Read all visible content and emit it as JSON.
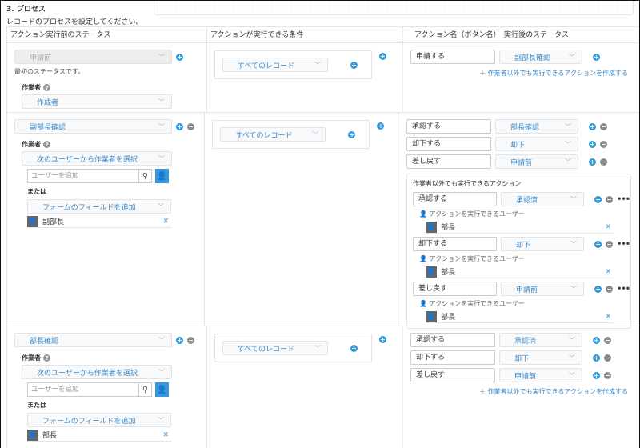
{
  "section_title": "3. プロセス",
  "subtitle": "レコードのプロセスを設定してください。",
  "headers": {
    "status_before": "アクション実行前のステータス",
    "condition": "アクションが実行できる条件",
    "action_name": "アクション名（ボタン名）",
    "status_after": "実行後のステータス"
  },
  "labels": {
    "assignee": "作業者",
    "or": "または",
    "user_search_placeholder": "ユーザーを追加",
    "first_status_note": "最初のステータスです。",
    "add_other_action": "＋ 作業者以外でも実行できるアクションを作成する",
    "other_actions_title": "作業者以外でも実行できるアクション",
    "action_users": "アクションを実行できるユーザー"
  },
  "rows": [
    {
      "status": "申請前",
      "assignee_mode": "作成者",
      "condition": "すべてのレコード",
      "actions": [
        {
          "name": "申請する",
          "next": "副部長確認"
        }
      ]
    },
    {
      "status": "副部長確認",
      "assignee_mode": "次のユーザーから作業者を選択",
      "field_select": "フォームのフィールドを追加",
      "assignee": "副部長",
      "condition": "すべてのレコード",
      "actions": [
        {
          "name": "承認する",
          "next": "部長確認"
        },
        {
          "name": "却下する",
          "next": "却下"
        },
        {
          "name": "差し戻す",
          "next": "申請前"
        }
      ],
      "other_actions": [
        {
          "name": "承認する",
          "next": "承認済",
          "user": "部長"
        },
        {
          "name": "却下する",
          "next": "却下",
          "user": "部長"
        },
        {
          "name": "差し戻す",
          "next": "申請前",
          "user": "部長"
        }
      ]
    },
    {
      "status": "部長確認",
      "assignee_mode": "次のユーザーから作業者を選択",
      "field_select": "フォームのフィールドを追加",
      "assignee": "部長",
      "condition": "すべてのレコード",
      "actions": [
        {
          "name": "承認する",
          "next": "承認済"
        },
        {
          "name": "却下する",
          "next": "却下"
        },
        {
          "name": "差し戻す",
          "next": "申請前"
        }
      ]
    }
  ],
  "colors": {
    "accent": "#3498db",
    "link": "#3a87c8"
  }
}
